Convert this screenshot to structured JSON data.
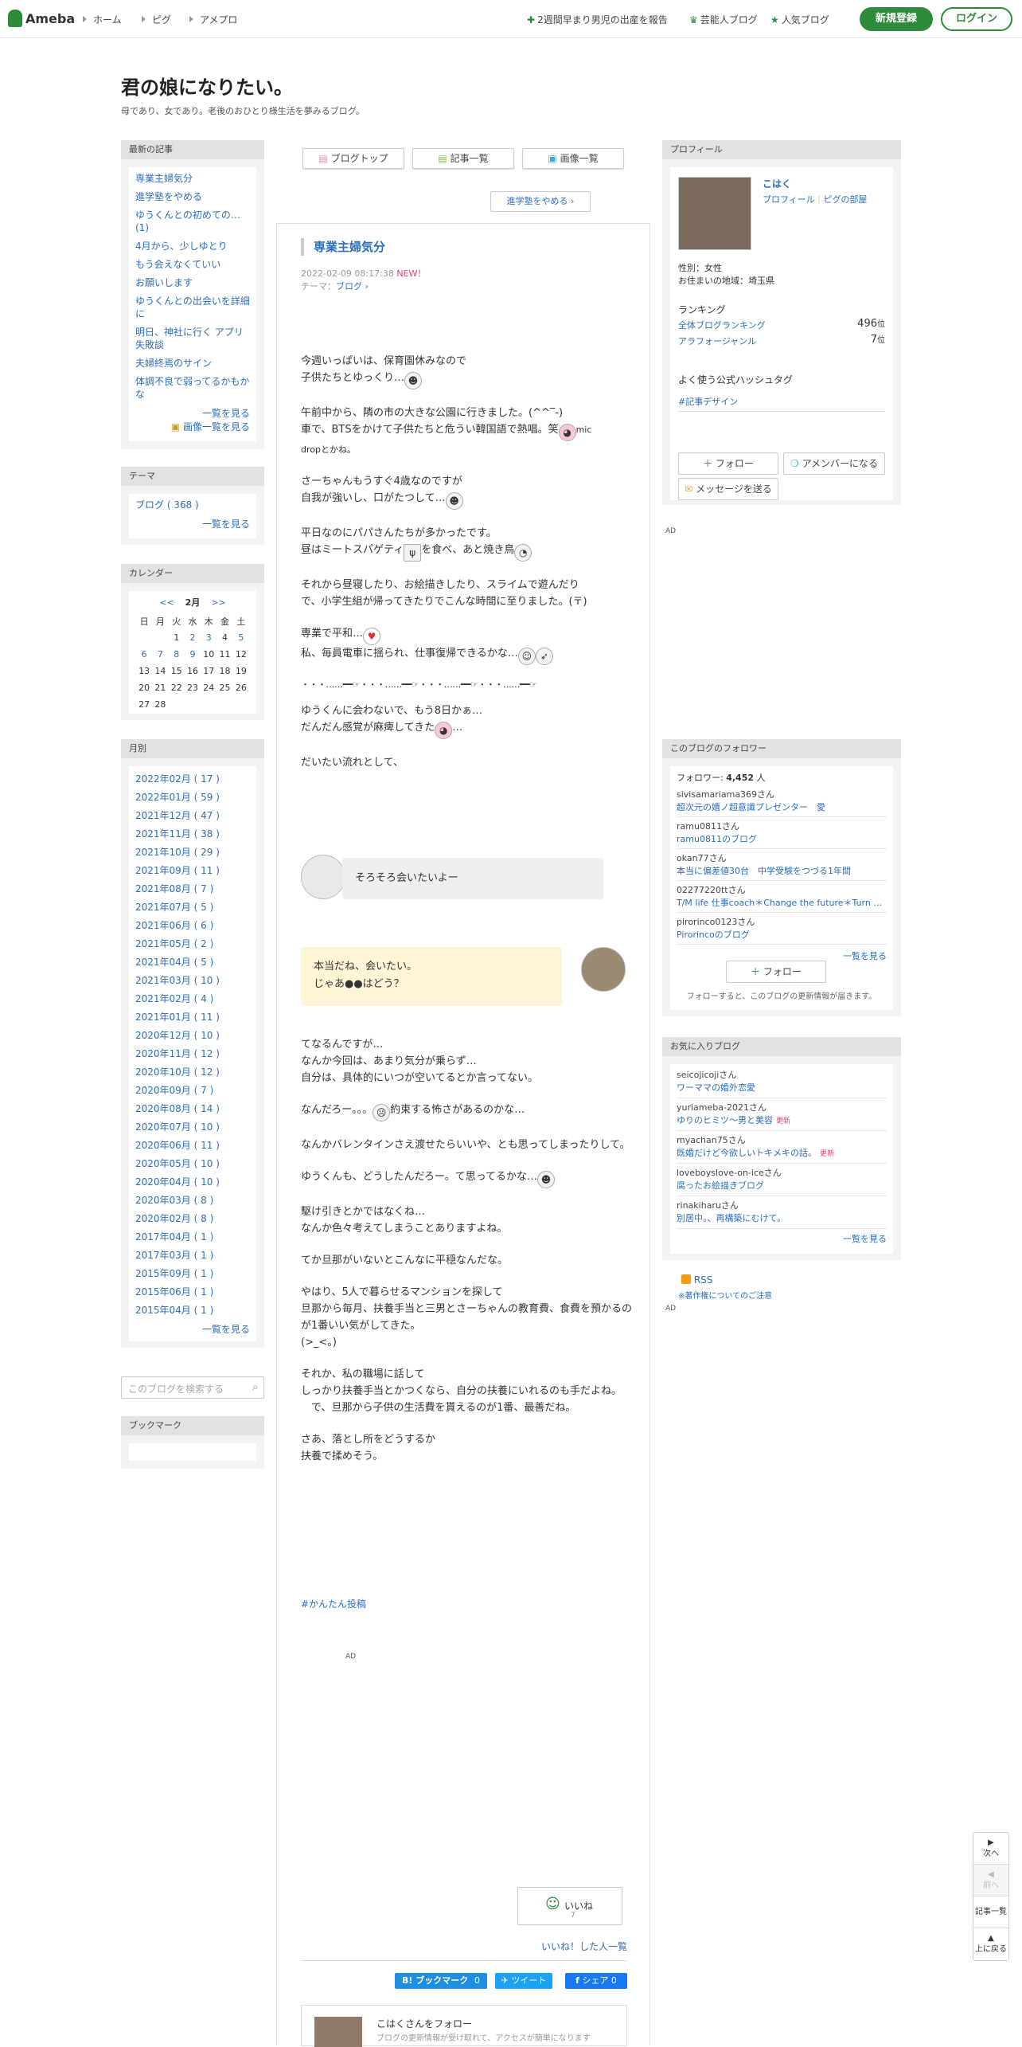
{
  "topbar": {
    "logo": "Ameba",
    "nav": [
      "ホーム",
      "ピグ",
      "アメプロ"
    ],
    "right_links": [
      "2週間早まり男児の出産を報告",
      "芸能人ブログ",
      "人気ブログ"
    ],
    "register": "新規登録",
    "login": "ログイン"
  },
  "blog": {
    "title": "君の娘になりたい。",
    "description": "母であり、女であり。老後のおひとり様生活を夢みるブログ。"
  },
  "left": {
    "recent_header": "最新の記事",
    "recent": [
      "専業主婦気分",
      "進学塾をやめる",
      "ゆうくんとの初めての…(1)",
      "4月から、少しゆとり",
      "もう会えなくていい",
      "お願いします",
      "ゆうくんとの出会いを詳細に",
      "明日、神社に行く アプリ失敗談",
      "夫婦終焉のサイン",
      "体調不良で弱ってるかもかな"
    ],
    "recent_more": "一覧を見る",
    "image_more": "画像一覧を見る",
    "theme_header": "テーマ",
    "theme": "ブログ ( 368 )",
    "theme_more": "一覧を見る",
    "calendar_header": "カレンダー",
    "cal_prev": "<<",
    "cal_month": "2月",
    "cal_next": ">>",
    "cal_days": [
      "日",
      "月",
      "火",
      "水",
      "木",
      "金",
      "土"
    ],
    "cal_rows": [
      [
        "",
        "",
        "1",
        "2",
        "3",
        "4",
        "5"
      ],
      [
        "6",
        "7",
        "8",
        "9",
        "10",
        "11",
        "12"
      ],
      [
        "13",
        "14",
        "15",
        "16",
        "17",
        "18",
        "19"
      ],
      [
        "20",
        "21",
        "22",
        "23",
        "24",
        "25",
        "26"
      ],
      [
        "27",
        "28",
        "",
        "",
        "",
        "",
        ""
      ]
    ],
    "monthly_header": "月別",
    "months": [
      "2022年02月 ( 17 )",
      "2022年01月 ( 59 )",
      "2021年12月 ( 47 )",
      "2021年11月 ( 38 )",
      "2021年10月 ( 29 )",
      "2021年09月 ( 11 )",
      "2021年08月 ( 7 )",
      "2021年07月 ( 5 )",
      "2021年06月 ( 6 )",
      "2021年05月 ( 2 )",
      "2021年04月 ( 5 )",
      "2021年03月 ( 10 )",
      "2021年02月 ( 4 )",
      "2021年01月 ( 11 )",
      "2020年12月 ( 10 )",
      "2020年11月 ( 12 )",
      "2020年10月 ( 12 )",
      "2020年09月 ( 7 )",
      "2020年08月 ( 14 )",
      "2020年07月 ( 10 )",
      "2020年06月 ( 11 )",
      "2020年05月 ( 10 )",
      "2020年04月 ( 10 )",
      "2020年03月 ( 8 )",
      "2020年02月 ( 8 )",
      "2017年04月 ( 1 )",
      "2017年03月 ( 1 )",
      "2015年09月 ( 1 )",
      "2015年06月 ( 1 )",
      "2015年04月 ( 1 )"
    ],
    "months_more": "一覧を見る",
    "search_placeholder": "このブログを検索する",
    "bookmark_header": "ブックマーク"
  },
  "main": {
    "tabs": [
      "ブログトップ",
      "記事一覧",
      "画像一覧"
    ],
    "prev_link": "進学塾をやめる",
    "entry_title": "専業主婦気分",
    "date": "2022-02-09 08:17:38",
    "new": "NEW！",
    "theme_label": "テーマ：",
    "theme": "ブログ",
    "p1a": "今週いっぱいは、保育園休みなので",
    "p1b": "子供たちとゆっくり…",
    "p2a": "午前中から、隣の市の大きな公園に行きました。(^^‾-)",
    "p2b": "車で、BTSをかけて子供たちと危うい韓国語で熱唱。笑",
    "p2c": "mic",
    "p2d": "dropとかね。",
    "p3a": "さーちゃんもうすぐ4歳なのですが",
    "p3b": "自我が強いし、口がたつして…",
    "p4a": "平日なのにパパさんたちが多かったです。",
    "p4b": "昼はミートスパゲティ",
    "p4c": "を食べ、あと焼き鳥",
    "p5a": "それから昼寝したり、お絵描きしたり、スライムで遊んだり",
    "p5b": "で、小学生組が帰ってきたりでこんな時間に至りました。(〒)",
    "p6a": "専業で平和…",
    "p6b": "私、毎員電車に揺られ、仕事復帰できるかな…",
    "divider": "・・・……━━☞・・・……━━☞・・・……━━☞・・・……━━☞",
    "p7a": "ゆうくんに会わないで、もう8日かぁ…",
    "p7b": "だんだん感覚が麻痺してきた",
    "p7c": "…",
    "p8": "だいたい流れとして、",
    "bubble1": "そろそろ会いたいよー",
    "bubble2a": "本当だね、会いたい。",
    "bubble2b": "じゃあ●●はどう？",
    "p9a": "てなるんですが…",
    "p9b": "なんか今回は、あまり気分が乗らず…",
    "p9c": "自分は、具体的にいつが空いてるとか言ってない。",
    "p10a": "なんだろー。。。",
    "p10b": "約束する怖さがあるのかな…",
    "p11": "なんかバレンタインさえ渡せたらいいや、とも思ってしまったりして。",
    "p12": "ゆうくんも、どうしたんだろー。て思ってるかな…",
    "p13a": "駆け引きとかではなくね…",
    "p13b": "なんか色々考えてしまうことありますよね。",
    "p14": "てか旦那がいないとこんなに平穏なんだな。",
    "p15a": "やはり、5人で暮らせるマンションを探して",
    "p15b": "旦那から毎月、扶養手当と三男とさーちゃんの教育費、食費を預かるのが1番いい気がしてきた。",
    "p15c": "(>_<。)",
    "p16a": "それか、私の職場に話して",
    "p16b": "しっかり扶養手当とかつくなら、自分の扶養にいれるのも手だよね。",
    "p16c": "　で、旦那から子供の生活費を貰えるのが1番、最善だね。",
    "p17a": "さあ、落とし所をどうするか",
    "p17b": "扶養で揉めそう。",
    "hashtag": "#かんたん投稿",
    "ad": "AD",
    "like_label": "いいね",
    "like_count": "7",
    "like_list": "いいね！した人一覧",
    "share": {
      "hatena": "B! ブックマーク",
      "hatena_count": "0",
      "tweet": "ツイート",
      "facebook": "シェア",
      "fb_count": "0"
    },
    "follow_card_title": "こはくさんをフォロー",
    "follow_card_desc": "ブログの更新情報が受け取れて、アクセスが簡単になります"
  },
  "right": {
    "profile_header": "プロフィール",
    "name": "こはく",
    "profile_link": "プロフィール",
    "pig_link": "ピグの部屋",
    "gender": "性別：女性",
    "area": "お住まいの地域：埼玉県",
    "ranking_label": "ランキング",
    "rank_all_label": "全体ブログランキング",
    "rank_all": "496",
    "rank_genre_label": "アラフォージャンル",
    "rank_genre": "7",
    "rank_unit": "位",
    "hashtag_label": "よく使う公式ハッシュタグ",
    "hashtag": "#記事デザイン",
    "follow_btn": "フォロー",
    "member_btn": "アメンバーになる",
    "message_btn": "メッセージを送る",
    "ad": "AD",
    "followers_header": "このブログのフォロワー",
    "followers_label": "フォロワー:",
    "followers_count": "4,452",
    "followers_unit": "人",
    "followers": [
      {
        "name": "sivisamariama369さん",
        "blog": "超次元の嬉ノ超意識プレゼンター　愛"
      },
      {
        "name": "ramu0811さん",
        "blog": "ramu0811のブログ"
      },
      {
        "name": "okan77さん",
        "blog": "本当に偏差値30台　中学受験をつづる1年間"
      },
      {
        "name": "02277220ttさん",
        "blog": "T/M life 仕事coach＊Change the future＊Turn …"
      },
      {
        "name": "pirorinco0123さん",
        "blog": "Pirorincoのブログ"
      }
    ],
    "followers_more": "一覧を見る",
    "follow_btn2": "フォロー",
    "follow_note": "フォローすると、このブログの更新情報が届きます。",
    "fav_header": "お気に入りブログ",
    "favs": [
      {
        "name": "seicojicojiさん",
        "blog": "ワーママの婚外恋愛",
        "upd": ""
      },
      {
        "name": "yuriameba-2021さん",
        "blog": "ゆりのヒミツ〜男と美容",
        "upd": "更新"
      },
      {
        "name": "myachan75さん",
        "blog": "既婚だけど今欲しいトキメキの話。",
        "upd": "更新"
      },
      {
        "name": "loveboyslove-on-iceさん",
        "blog": "腐ったお絵描きブログ",
        "upd": ""
      },
      {
        "name": "rinakiharuさん",
        "blog": "別居中。、再構築にむけて。",
        "upd": ""
      }
    ],
    "fav_more": "一覧を見る",
    "rss": "RSS",
    "copyright_note": "※著作権についてのご注意",
    "ad2": "AD"
  },
  "pagenav": {
    "next": "次へ",
    "prev": "前へ",
    "list": "記事一覧",
    "top": "上に戻る"
  }
}
